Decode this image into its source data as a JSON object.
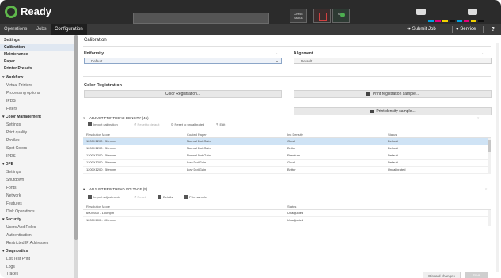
{
  "header": {
    "status": "Ready",
    "check_label": "Check Status",
    "stop_label": "Stop",
    "start_label": "Start"
  },
  "nav": {
    "tabs": [
      "Operations",
      "Jobs",
      "Configuration"
    ],
    "active_tab": "Configuration",
    "submit_job": "Submit Job",
    "service": "Service",
    "help": "?"
  },
  "sidebar": {
    "items": [
      {
        "label": "Settings"
      },
      {
        "label": "Calibration"
      },
      {
        "label": "Maintenance"
      },
      {
        "label": "Paper"
      },
      {
        "label": "Printer Presets"
      },
      {
        "label": "Workflow"
      },
      {
        "label": "Virtual Printers"
      },
      {
        "label": "Processing options"
      },
      {
        "label": "IPDS"
      },
      {
        "label": "Filters"
      },
      {
        "label": "Color Management"
      },
      {
        "label": "Settings"
      },
      {
        "label": "Print quality"
      },
      {
        "label": "Profiles"
      },
      {
        "label": "Spot Colors"
      },
      {
        "label": "IPDS"
      },
      {
        "label": "DFE"
      },
      {
        "label": "Settings"
      },
      {
        "label": "Shutdown"
      },
      {
        "label": "Fonts"
      },
      {
        "label": "Network"
      },
      {
        "label": "Features"
      },
      {
        "label": "Disk Operations"
      },
      {
        "label": "Security"
      },
      {
        "label": "Users And Roles"
      },
      {
        "label": "Authentication"
      },
      {
        "label": "Restricted IP Addresses"
      },
      {
        "label": "Diagnostics"
      },
      {
        "label": "List/Test Print"
      },
      {
        "label": "Logs"
      },
      {
        "label": "Traces"
      }
    ]
  },
  "main": {
    "title": "Calibration",
    "uniformity": {
      "label": "Uniformity",
      "value": "Default"
    },
    "alignment": {
      "label": "Alignment",
      "value": "Default"
    },
    "color_registration": {
      "heading": "Color Registration",
      "button": "Color Registration...",
      "print_registration": "Print registration sample...",
      "print_density": "Print density sample..."
    },
    "density_panel": {
      "title": "ADJUST PRINTHEAD DENSITY (45)",
      "toolbar": [
        "Import calibration",
        "Reset to default",
        "Reset to uncalibrated",
        "Edit"
      ],
      "columns": [
        "Resolution Mode",
        "Coated Paper",
        "Ink Density",
        "Status"
      ],
      "rows": [
        [
          "1200X1200 - 50mpm",
          "Normal Dot Gain",
          "Good",
          "Default"
        ],
        [
          "1200X1200 - 50mpm",
          "Normal Dot Gain",
          "Better",
          "Default"
        ],
        [
          "1200X1200 - 50mpm",
          "Normal Dot Gain",
          "Premium",
          "Default"
        ],
        [
          "1200X1200 - 50mpm",
          "Low Dot Gain",
          "Good",
          "Default"
        ],
        [
          "1200X1200 - 50mpm",
          "Low Dot Gain",
          "Better",
          "Uncalibrated"
        ]
      ]
    },
    "voltage_panel": {
      "title": "ADJUST PRINTHEAD VOLTAGE (5)",
      "toolbar": [
        "Import adjustments",
        "Reset",
        "Details",
        "Print sample"
      ],
      "columns": [
        "Resolution Mode",
        "Status"
      ],
      "rows": [
        [
          "600X600 - 150mpm",
          "Unadjusted"
        ],
        [
          "1200X600 - 100mpm",
          "Unadjusted"
        ]
      ]
    },
    "footer": {
      "discard": "Discard changes",
      "save": "Save"
    }
  }
}
